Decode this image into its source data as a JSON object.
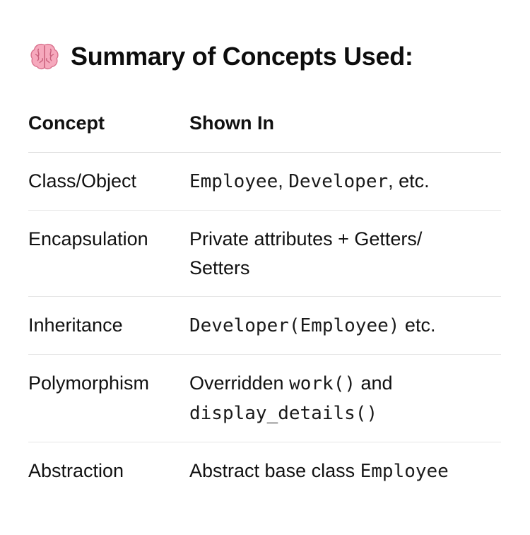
{
  "heading": {
    "icon": "brain-icon",
    "text": "Summary of Concepts Used:"
  },
  "table": {
    "headers": [
      "Concept",
      "Shown In"
    ],
    "rows": [
      {
        "concept": "Class/Object",
        "shown": [
          {
            "type": "code",
            "text": "Employee"
          },
          {
            "type": "text",
            "text": ", "
          },
          {
            "type": "code",
            "text": "Developer"
          },
          {
            "type": "text",
            "text": ", etc."
          }
        ]
      },
      {
        "concept": "Encapsulation",
        "shown": [
          {
            "type": "text",
            "text": "Private attributes + Getters/"
          },
          {
            "type": "br"
          },
          {
            "type": "text",
            "text": "Setters"
          }
        ]
      },
      {
        "concept": "Inheritance",
        "shown": [
          {
            "type": "code",
            "text": "Developer(Employee)"
          },
          {
            "type": "text",
            "text": " etc."
          }
        ]
      },
      {
        "concept": "Polymorphism",
        "shown": [
          {
            "type": "text",
            "text": "Overridden "
          },
          {
            "type": "code",
            "text": "work()"
          },
          {
            "type": "text",
            "text": " and"
          },
          {
            "type": "br"
          },
          {
            "type": "code",
            "text": "display_details()"
          }
        ]
      },
      {
        "concept": "Abstraction",
        "shown": [
          {
            "type": "text",
            "text": "Abstract base class "
          },
          {
            "type": "code",
            "text": "Employee"
          }
        ]
      }
    ]
  }
}
